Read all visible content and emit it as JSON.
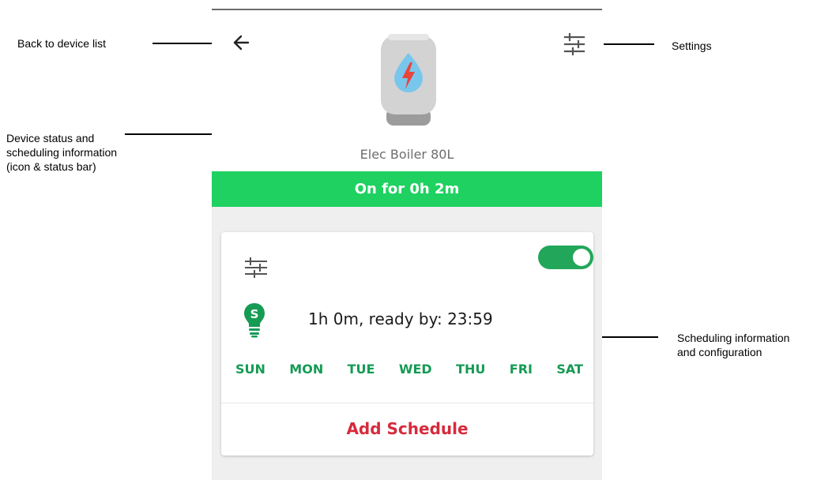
{
  "device": {
    "name": "Elec Boiler 80L",
    "status": "On for 0h 2m"
  },
  "schedule": {
    "enabled": true,
    "summary": "1h 0m, ready by: 23:59",
    "days": [
      "SUN",
      "MON",
      "TUE",
      "WED",
      "THU",
      "FRI",
      "SAT"
    ],
    "add_label": "Add Schedule"
  },
  "annotations": {
    "back": "Back to device list",
    "settings": "Settings",
    "status_line1": "Device status and",
    "status_line2": "scheduling information",
    "status_line3": "(icon & status bar)",
    "scheduling_line1": "Scheduling information",
    "scheduling_line2": "and configuration"
  },
  "colors": {
    "status_green": "#1fd161",
    "toggle_green": "#22a75a",
    "day_green": "#169b55",
    "add_red": "#d52b3c"
  },
  "icons": {
    "back": "arrow-left-icon",
    "settings": "sliders-icon",
    "device": "water-heater-icon",
    "schedule": "schedule-bulb-icon"
  }
}
